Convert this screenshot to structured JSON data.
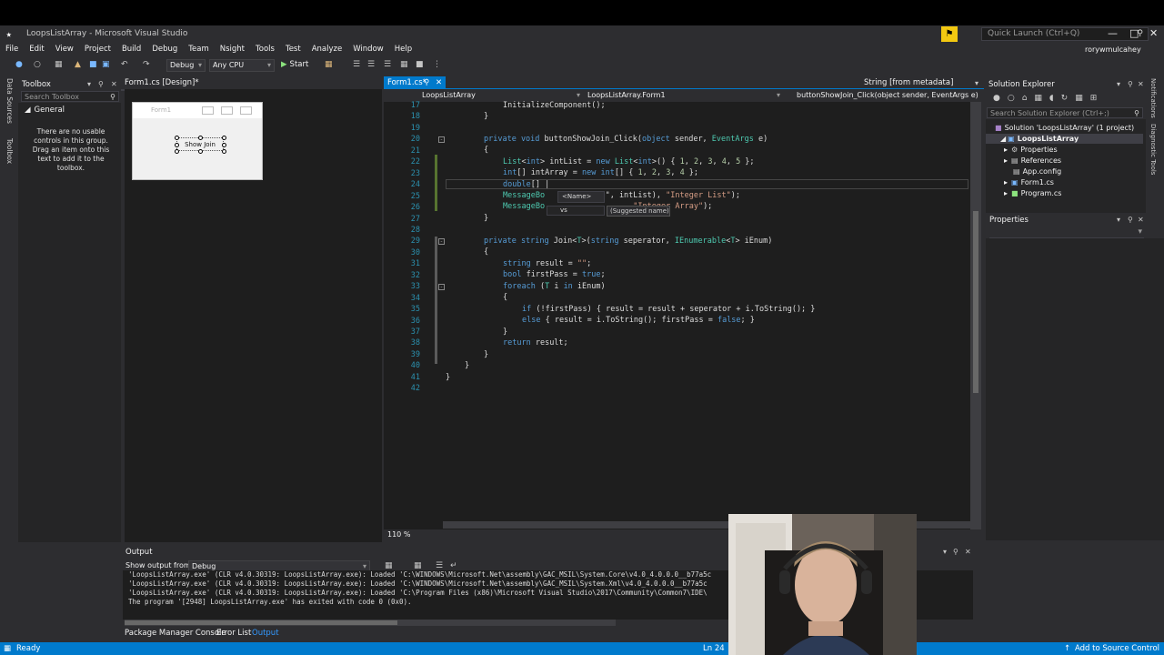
{
  "window": {
    "title": "LoopsListArray - Microsoft Visual Studio",
    "quick_launch_placeholder": "Quick Launch (Ctrl+Q)",
    "user": "rorywmulcahey"
  },
  "menu": [
    "File",
    "Edit",
    "View",
    "Project",
    "Build",
    "Debug",
    "Team",
    "Nsight",
    "Tools",
    "Test",
    "Analyze",
    "Window",
    "Help"
  ],
  "toolbar": {
    "config": "Debug",
    "platform": "Any CPU",
    "start_label": "Start"
  },
  "toolbox": {
    "title": "Toolbox",
    "search_placeholder": "Search Toolbox",
    "group": "General",
    "message": "There are no usable controls in this group. Drag an item onto this text to add it to the toolbox."
  },
  "designer": {
    "tab_label": "Form1.cs [Design]*",
    "form_caption": "Form1",
    "button_label": "Show Join"
  },
  "editor": {
    "tab_label": "Form1.cs*",
    "nav_project": "LoopsListArray",
    "nav_class": "LoopsListArray.Form1",
    "nav_member": "buttonShowJoin_Click(object sender, EventArgs e)",
    "metadata_tab": "String [from metadata]",
    "line_numbers": [
      "17",
      "18",
      "19",
      "20",
      "21",
      "22",
      "23",
      "24",
      "25",
      "26",
      "27",
      "28",
      "29",
      "30",
      "31",
      "32",
      "33",
      "34",
      "35",
      "36",
      "37",
      "38",
      "39",
      "40",
      "41",
      "42"
    ],
    "intellisense_name": "<Name>",
    "intellisense_value": "vs",
    "suggested_name": "(Suggested name)",
    "zoom": "110 %"
  },
  "solution_explorer": {
    "title": "Solution Explorer",
    "search_placeholder": "Search Solution Explorer (Ctrl+;)",
    "items": [
      {
        "label": "Solution 'LoopsListArray' (1 project)"
      },
      {
        "label": "LoopsListArray"
      },
      {
        "label": "Properties"
      },
      {
        "label": "References"
      },
      {
        "label": "App.config"
      },
      {
        "label": "Form1.cs"
      },
      {
        "label": "Program.cs"
      }
    ]
  },
  "properties": {
    "title": "Properties"
  },
  "output": {
    "title": "Output",
    "show_from_label": "Show output from:",
    "show_from_value": "Debug",
    "lines": [
      "'LoopsListArray.exe' (CLR v4.0.30319: LoopsListArray.exe): Loaded 'C:\\WINDOWS\\Microsoft.Net\\assembly\\GAC_MSIL\\System.Core\\v4.0_4.0.0.0__b77a5c",
      "'LoopsListArray.exe' (CLR v4.0.30319: LoopsListArray.exe): Loaded 'C:\\WINDOWS\\Microsoft.Net\\assembly\\GAC_MSIL\\System.Xml\\v4.0_4.0.0.0__b77a5c",
      "'LoopsListArray.exe' (CLR v4.0.30319: LoopsListArray.exe): Loaded 'C:\\Program Files (x86)\\Microsoft Visual Studio\\2017\\Community\\Common7\\IDE\\",
      "The program '[2948] LoopsListArray.exe' has exited with code 0 (0x0)."
    ]
  },
  "bottom_tabs": [
    "Package Manager Console",
    "Error List",
    "Output"
  ],
  "status": {
    "ready": "Ready",
    "line": "Ln 24",
    "source_control": "Add to Source Control"
  }
}
